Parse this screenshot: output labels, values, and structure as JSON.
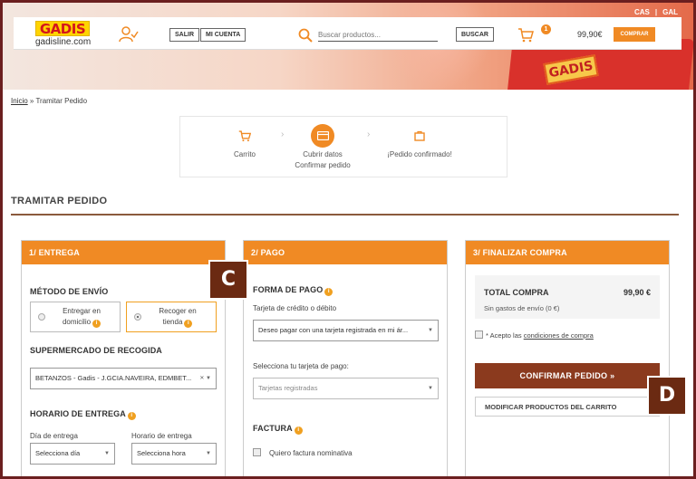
{
  "header": {
    "logo_text": "GADIS",
    "site_name": "gadisline.com",
    "lang_cas": "CAS",
    "lang_sep": "|",
    "lang_gal": "GAL",
    "salir_label": "SALIR",
    "mi_cuenta_label": "MI CUENTA",
    "search_placeholder": "Buscar productos...",
    "buscar_label": "BUSCAR",
    "cart_count": "1",
    "cart_total": "99,90€",
    "comprar_label": "COMPRAR"
  },
  "breadcrumb": {
    "home": "Inicio",
    "separator": " » ",
    "current": "Tramitar Pedido"
  },
  "stepper": {
    "steps": [
      {
        "line1": "Carrito",
        "line2": ""
      },
      {
        "line1": "Cubrir datos",
        "line2": "Confirmar pedido"
      },
      {
        "line1": "¡Pedido confirmado!",
        "line2": ""
      }
    ]
  },
  "page_title": "TRAMITAR PEDIDO",
  "entrega": {
    "heading": "1/ ENTREGA",
    "metodo_label": "MÉTODO DE ENVÍO",
    "option_home_line1": "Entregar en",
    "option_home_line2": "domicilio",
    "option_store_line1": "Recoger en",
    "option_store_line2": "tienda",
    "supermercado_label": "SUPERMERCADO DE RECOGIDA",
    "supermercado_value": "BETANZOS - Gadis - J.GCIA.NAVEIRA, EDMBET...",
    "horario_label": "HORARIO DE ENTREGA",
    "dia_label": "Día de entrega",
    "dia_value": "Selecciona día",
    "hora_label": "Horario de entrega",
    "hora_value": "Selecciona hora"
  },
  "pago": {
    "heading": "2/ PAGO",
    "forma_label": "FORMA DE PAGO",
    "tarjeta_label": "Tarjeta de crédito o débito",
    "tarjeta_value": "Deseo pagar con una tarjeta registrada en mi ár...",
    "selecciona_label": "Selecciona tu tarjeta de pago:",
    "registradas_value": "Tarjetas registradas",
    "factura_label": "FACTURA",
    "factura_check_label": "Quiero factura nominativa"
  },
  "finalizar": {
    "heading": "3/ FINALIZAR COMPRA",
    "total_label": "TOTAL COMPRA",
    "total_value": "99,90 €",
    "gastos_text": "Sin gastos de envío (0 €)",
    "acepto_prefix": "* Acepto las ",
    "acepto_link": "condiciones de compra",
    "confirm_label": "CONFIRMAR PEDIDO",
    "modify_label": "MODIFICAR PRODUCTOS DEL CARRITO"
  },
  "markers": {
    "c": "C",
    "d": "D"
  },
  "colors": {
    "accent": "#f08a24",
    "confirm": "#8b3a1e",
    "marker": "#6b2a12",
    "frame": "#6b1f1f"
  },
  "icons": [
    "user-check-icon",
    "search-icon",
    "cart-icon",
    "info-icon",
    "card-icon",
    "bag-icon",
    "chevron-right-icon"
  ]
}
